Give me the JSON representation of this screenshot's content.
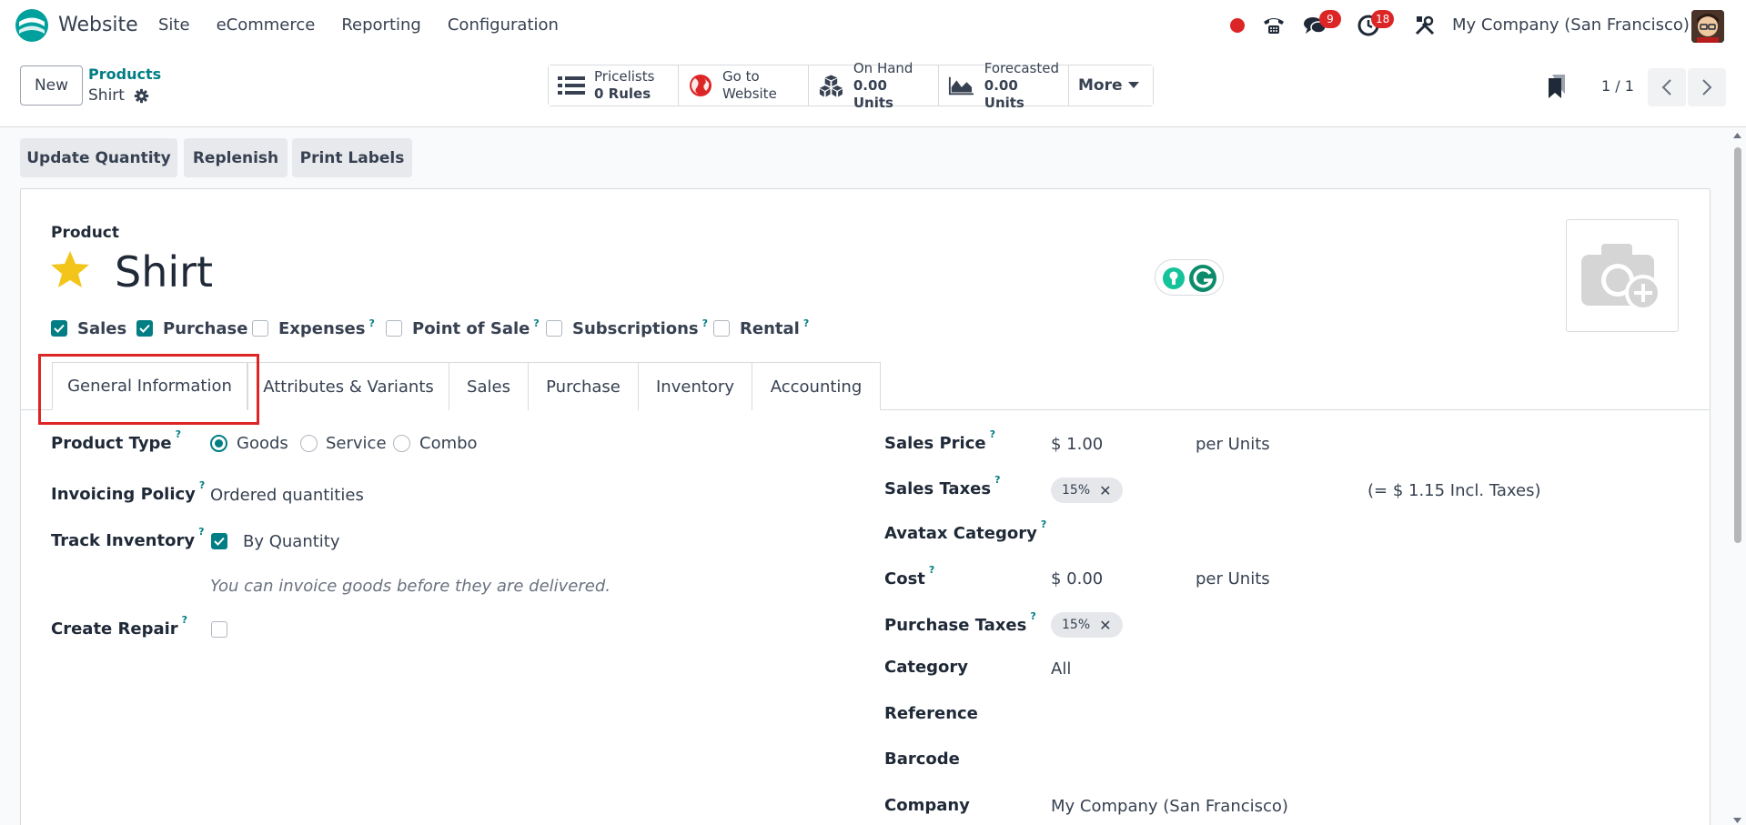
{
  "navbar": {
    "app_name": "Website",
    "menu": [
      "Site",
      "eCommerce",
      "Reporting",
      "Configuration"
    ],
    "chat_badge": "9",
    "activity_badge": "18",
    "company": "My Company (San Francisco)"
  },
  "control_panel": {
    "new_label": "New",
    "breadcrumb_parent": "Products",
    "breadcrumb_current": "Shirt",
    "smart_buttons": {
      "pricelists": {
        "line1": "Pricelists",
        "line2": "0 Rules"
      },
      "website": {
        "line1": "Go to",
        "line2": "Website"
      },
      "on_hand": {
        "line1": "On Hand",
        "line2": "0.00 Units"
      },
      "forecasted": {
        "line1": "Forecasted",
        "line2": "0.00 Units"
      },
      "more": "More"
    },
    "pager": "1 / 1"
  },
  "actions": [
    "Update Quantity",
    "Replenish",
    "Print Labels"
  ],
  "product": {
    "label": "Product",
    "name": "Shirt",
    "flags": [
      {
        "label": "Sales",
        "checked": true
      },
      {
        "label": "Purchase",
        "checked": true
      },
      {
        "label": "Expenses",
        "checked": false,
        "help": "?"
      },
      {
        "label": "Point of Sale",
        "checked": false,
        "help": "?"
      },
      {
        "label": "Subscriptions",
        "checked": false,
        "help": "?"
      },
      {
        "label": "Rental",
        "checked": false,
        "help": "?"
      }
    ]
  },
  "tabs": [
    "General Information",
    "Attributes & Variants",
    "Sales",
    "Purchase",
    "Inventory",
    "Accounting"
  ],
  "left_fields": {
    "product_type_label": "Product Type",
    "product_type_options": [
      "Goods",
      "Service",
      "Combo"
    ],
    "product_type_selected": "Goods",
    "invoicing_policy_label": "Invoicing Policy",
    "invoicing_policy_value": "Ordered quantities",
    "track_inventory_label": "Track Inventory",
    "track_inventory_value": "By Quantity",
    "hint": "You can invoice goods before they are delivered.",
    "create_repair_label": "Create Repair"
  },
  "right_fields": {
    "sales_price_label": "Sales Price",
    "sales_price_value": "$ 1.00",
    "sales_price_unit": "per Units",
    "sales_taxes_label": "Sales Taxes",
    "sales_taxes_tag": "15%",
    "sales_taxes_incl": "(= $ 1.15 Incl. Taxes)",
    "avatax_label": "Avatax Category",
    "cost_label": "Cost",
    "cost_value": "$ 0.00",
    "cost_unit": "per Units",
    "purchase_taxes_label": "Purchase Taxes",
    "purchase_taxes_tag": "15%",
    "category_label": "Category",
    "category_value": "All",
    "reference_label": "Reference",
    "barcode_label": "Barcode",
    "company_label": "Company",
    "company_value": "My Company (San Francisco)"
  },
  "help_mark": "?",
  "colors": {
    "accent": "#017e84",
    "danger": "#dc2626",
    "brand_purple": "#714b67"
  }
}
